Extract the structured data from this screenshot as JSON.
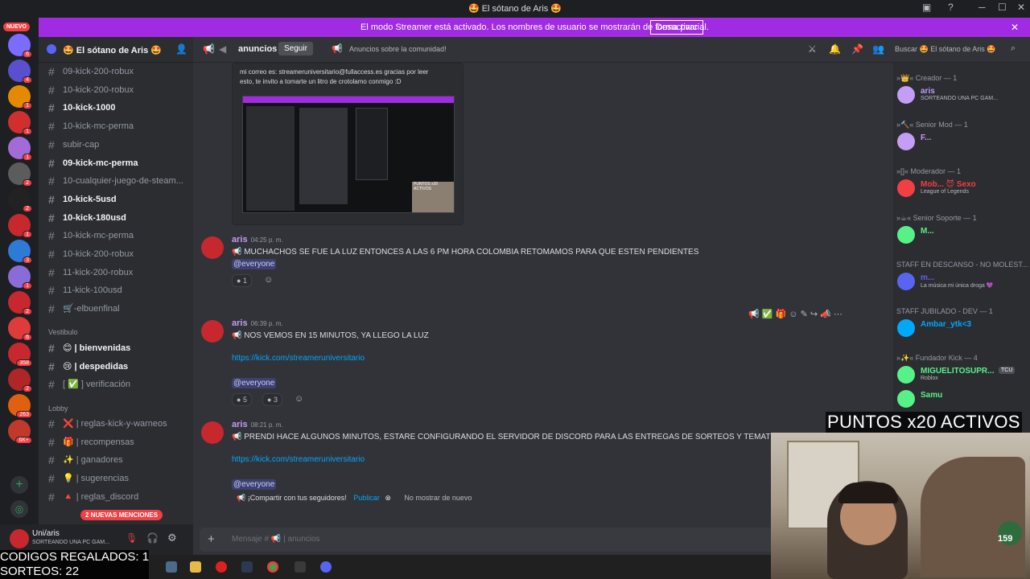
{
  "window": {
    "title": "🤩 El sótano de Aris 🤩"
  },
  "streamer_bar": {
    "message": "El modo Streamer está activado. Los nombres de usuario se mostrarán de forma parcial.",
    "button": "Desactivar"
  },
  "server": {
    "name": "🤩 El sótano de Aris 🤩"
  },
  "channel_header": {
    "name": "anuncios",
    "follow": "Seguir",
    "topic": "Anuncios sobre la comunidad!",
    "search": "Buscar 🤩 El sótano de Aris 🤩"
  },
  "guild_badge_new": "NUEVO",
  "guild_badges": [
    "6",
    "4",
    "1",
    "1",
    "1",
    "2",
    "2",
    "1",
    "3",
    "1",
    "2",
    "6",
    "358",
    "2",
    "263",
    "6K+"
  ],
  "channels": [
    {
      "name": "09-kick-200-robux",
      "unread": false
    },
    {
      "name": "10-kick-200-robux",
      "unread": false
    },
    {
      "name": "10-kick-1000",
      "unread": true
    },
    {
      "name": "10-kick-mc-perma",
      "unread": false
    },
    {
      "name": "subir-cap",
      "unread": false
    },
    {
      "name": "09-kick-mc-perma",
      "unread": true
    },
    {
      "name": "10-cualquier-juego-de-steam...",
      "unread": false
    },
    {
      "name": "10-kick-5usd",
      "unread": true
    },
    {
      "name": "10-kick-180usd",
      "unread": true
    },
    {
      "name": "10-kick-mc-perma",
      "unread": false
    },
    {
      "name": "10-kick-200-robux",
      "unread": false
    },
    {
      "name": "11-kick-200-robux",
      "unread": false
    },
    {
      "name": "11-kick-100usd",
      "unread": false
    },
    {
      "name": "🛒-elbuenfinal",
      "unread": false
    }
  ],
  "category_vestibulo": "Vestibulo",
  "vestibulo_channels": [
    {
      "name": "😊 | bienvenidas",
      "unread": true
    },
    {
      "name": "😢 | despedidas",
      "unread": true
    },
    {
      "name": "[ ✅ ] verificación",
      "unread": false
    }
  ],
  "category_lobby": "Lobby",
  "lobby_channels": [
    {
      "name": "❌ | reglas-kick-y-warneos"
    },
    {
      "name": "🎁 | recompensas"
    },
    {
      "name": "✨ | ganadores"
    },
    {
      "name": "💡 | sugerencias"
    },
    {
      "name": "🔺 | reglas_discord"
    }
  ],
  "mentions_pill": "2 NUEVAS MENCIONES",
  "user_panel": {
    "name": "Uni/aris",
    "status": "SORTEANDO UNA PC GAM..."
  },
  "prev_message": {
    "line1": "mi correo es: streameruniversitario@fullaccess.es gracias por leer",
    "line2": "esto, te invito a tomarte un litro de crotolamo conmigo :D",
    "webcam_label": "PUNTOS x20 ACTIVOS"
  },
  "messages": [
    {
      "author": "aris",
      "time": "04:25 p. m.",
      "text": "📢 MUCHACHOS SE FUE LA LUZ ENTONCES A LAS 6 PM HORA COLOMBIA RETOMAMOS PARA QUE ESTEN PENDIENTES",
      "mention": "@everyone",
      "reactions": [
        {
          "count": "1"
        }
      ]
    },
    {
      "author": "aris",
      "time": "06:39 p. m.",
      "text": "📢 NOS VEMOS EN 15 MINUTOS, YA LLEGO LA LUZ",
      "link": "https://kick.com/streameruniversitario",
      "mention": "@everyone",
      "reactions": [
        {
          "count": "5"
        },
        {
          "count": "3"
        }
      ]
    },
    {
      "author": "aris",
      "time": "08:21 p. m.",
      "text": "📢 PRENDI HACE ALGUNOS MINUTOS, ESTARE CONFIGURANDO EL SERVIDOR DE DISCORD PARA LAS ENTREGAS DE SORTEOS Y TEMATICAS!",
      "link": "https://kick.com/streameruniversitario",
      "mention": "@everyone"
    }
  ],
  "share_bar": {
    "text": "¡Compartir con tus seguidores!",
    "publish": "Publicar",
    "dismiss": "No mostrar de nuevo"
  },
  "composer": {
    "placeholder": "Mensaje # 📢 | anuncios"
  },
  "members": {
    "roles": [
      {
        "label": "»👑« Creador — 1",
        "members": [
          {
            "name": "aris",
            "status": "SORTEANDO UNA PC GAM...",
            "color": "#c49df5"
          }
        ]
      },
      {
        "label": "»🔨« Senior Mod — 1",
        "members": [
          {
            "name": "F...",
            "status": "",
            "color": "#c49df5"
          }
        ]
      },
      {
        "label": "»[]« Moderador — 1",
        "members": [
          {
            "name": "Mob... 😈 Sexo",
            "status": "League of Legends",
            "color": "#f23f43"
          }
        ]
      },
      {
        "label": "»☕« Senior Soporte — 1",
        "members": [
          {
            "name": "M...",
            "status": "",
            "color": "#57f287"
          }
        ]
      },
      {
        "label": "STAFF EN DESCANSO - NO MOLEST...",
        "members": [
          {
            "name": "m...",
            "status": "La música mi única droga 💜",
            "color": "#5865f2"
          }
        ]
      },
      {
        "label": "STAFF JUBILADO - DEV — 1",
        "members": [
          {
            "name": "Ambar_ytk<3",
            "status": "",
            "color": "#00a8fc"
          }
        ]
      },
      {
        "label": "»✨« Fundador Kick — 4",
        "members": [
          {
            "name": "MIGUELITOSUPR...",
            "status": "Roblox",
            "color": "#57f287",
            "tag": "TCU"
          },
          {
            "name": "Samu",
            "status": "",
            "color": "#57f287"
          }
        ]
      }
    ]
  },
  "stream_overlay": {
    "codes": "CODIGOS REGALADOS: 1",
    "raffles": "SORTEOS: 22",
    "points": "PUNTOS x20 ACTIVOS",
    "cam_counter": "159"
  },
  "colors": {
    "accent": "#5865f2",
    "streamer": "#a12be2",
    "mention_red": "#f23f43"
  }
}
